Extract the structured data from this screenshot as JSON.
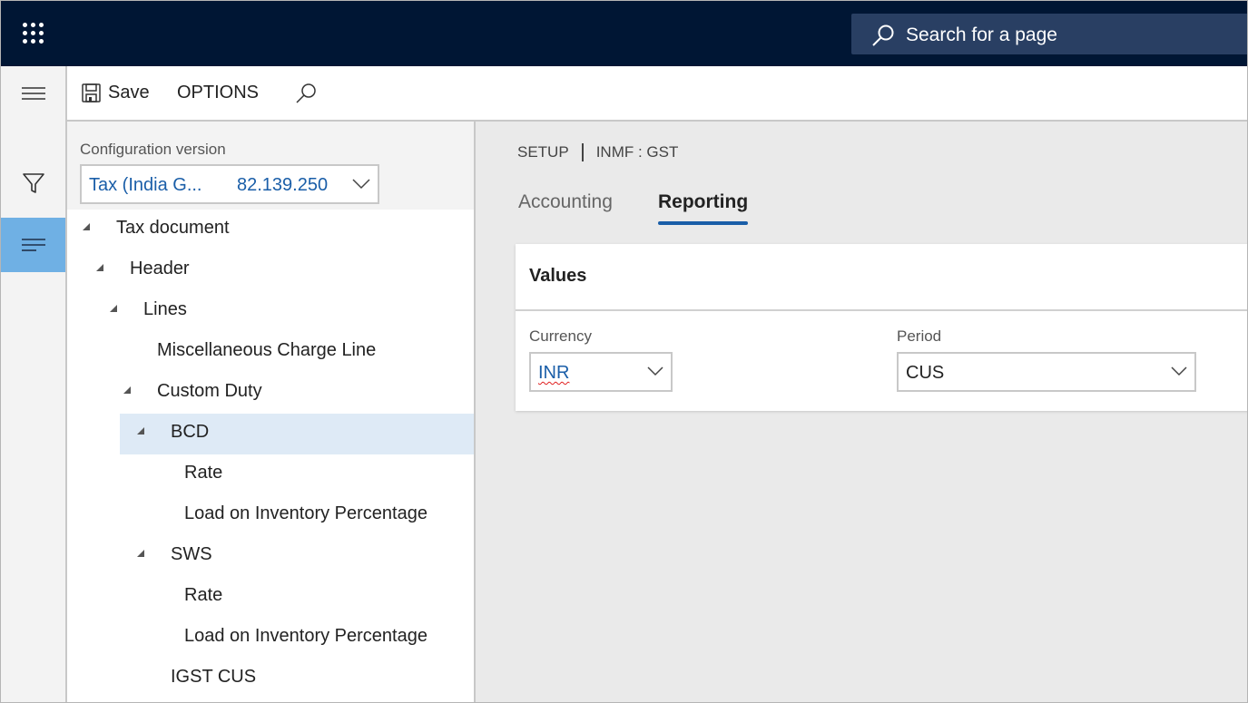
{
  "topbar": {
    "apps_icon": "waffle-grid-icon",
    "search_placeholder": "Search for a page",
    "search_icon": "search-icon"
  },
  "rail": {
    "items": [
      {
        "icon": "hamburger-menu-icon",
        "active": false
      },
      {
        "icon": "filter-icon",
        "active": false
      },
      {
        "icon": "list-lines-icon",
        "active": true
      }
    ]
  },
  "actionbar": {
    "save_label": "Save",
    "options_label": "OPTIONS",
    "search_icon": "search-icon"
  },
  "config": {
    "label": "Configuration version",
    "name": "Tax (India G...",
    "version": "82.139.250"
  },
  "tree": {
    "nodes": [
      {
        "label": "Tax document",
        "level": 0,
        "expanded": true
      },
      {
        "label": "Header",
        "level": 1,
        "expanded": true
      },
      {
        "label": "Lines",
        "level": 2,
        "expanded": true
      },
      {
        "label": "Miscellaneous Charge Line",
        "level": 3,
        "expanded": null
      },
      {
        "label": "Custom Duty",
        "level": 3,
        "expanded": true
      },
      {
        "label": "BCD",
        "level": 4,
        "expanded": true,
        "selected": true
      },
      {
        "label": "Rate",
        "level": 5,
        "expanded": null
      },
      {
        "label": "Load on Inventory Percentage",
        "level": 5,
        "expanded": null
      },
      {
        "label": "SWS",
        "level": 4,
        "expanded": true
      },
      {
        "label": "Rate",
        "level": 5,
        "expanded": null
      },
      {
        "label": "Load on Inventory Percentage",
        "level": 5,
        "expanded": null
      },
      {
        "label": "IGST CUS",
        "level": 4,
        "expanded": null
      }
    ]
  },
  "main": {
    "breadcrumb": {
      "section": "SETUP",
      "item": "INMF : GST"
    },
    "tabs": [
      {
        "label": "Accounting",
        "active": false
      },
      {
        "label": "Reporting",
        "active": true
      }
    ],
    "card": {
      "title": "Values",
      "currency_label": "Currency",
      "currency_value": "INR",
      "period_label": "Period",
      "period_value": "CUS"
    }
  },
  "colors": {
    "topbar_bg": "#001634",
    "accent": "#1a5ea8",
    "rail_active": "#6fb0e4",
    "selected_row": "#deeaf6"
  }
}
